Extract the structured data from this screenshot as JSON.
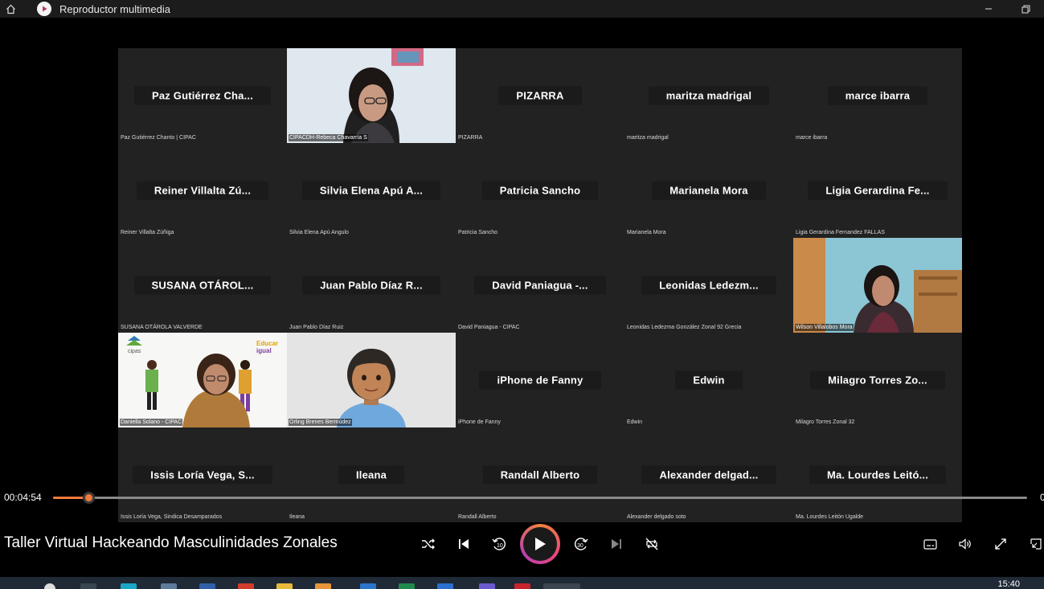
{
  "window": {
    "title": "Reproductor multimedia"
  },
  "tiles": [
    {
      "name": "Paz Gutiérrez Cha...",
      "label": "Paz Gutiérrez Chanto | CIPAC",
      "video": false
    },
    {
      "name": "",
      "label": "CIPACDH-Rebeca Chavarría S",
      "video": true
    },
    {
      "name": "PIZARRA",
      "label": "PIZARRA",
      "video": false
    },
    {
      "name": "maritza madrigal",
      "label": "maritza madrigal",
      "video": false
    },
    {
      "name": "marce ibarra",
      "label": "marce ibarra",
      "video": false
    },
    {
      "name": "Reiner Villalta Zú...",
      "label": "Reiner Villalta Zúñiga",
      "video": false
    },
    {
      "name": "Silvia Elena Apú A...",
      "label": "Silvia Elena Apú Angulo",
      "video": false
    },
    {
      "name": "Patricia Sancho",
      "label": "Patricia Sancho",
      "video": false
    },
    {
      "name": "Marianela Mora",
      "label": "Marianela Mora",
      "video": false
    },
    {
      "name": "Ligia Gerardina Fe...",
      "label": "Ligia Gerardina Fernandez FALLAS",
      "video": false
    },
    {
      "name": "SUSANA OTÁROL...",
      "label": "SUSANA OTÁROLA VALVERDE",
      "video": false
    },
    {
      "name": "Juan Pablo Díaz R...",
      "label": "Juan Pablo Díaz Ruiz",
      "video": false
    },
    {
      "name": "David Paniagua -...",
      "label": "David Paniagua - CIPAC",
      "video": false
    },
    {
      "name": "Leonidas Ledezm...",
      "label": "Leonidas Ledezma González Zonal 92 Grecia",
      "video": false
    },
    {
      "name": "",
      "label": "Wilson Villalobos Mora",
      "video": true
    },
    {
      "name": "",
      "label": "Daniella Solano - CIPAC",
      "video": true
    },
    {
      "name": "",
      "label": "Orling Brenes Bermúdez",
      "video": true
    },
    {
      "name": "iPhone de Fanny",
      "label": "iPhone de Fanny",
      "video": false
    },
    {
      "name": "Edwin",
      "label": "Edwin",
      "video": false
    },
    {
      "name": "Milagro Torres Zo...",
      "label": "Milagro Torres Zonal 32",
      "video": false
    },
    {
      "name": "Issis Loría Vega, S...",
      "label": "Issis Loría Vega, Sindica Desamparados",
      "video": false
    },
    {
      "name": "Ileana",
      "label": "Ileana",
      "video": false
    },
    {
      "name": "Randall Alberto",
      "label": "Randall Alberto",
      "video": false
    },
    {
      "name": "Alexander delgad...",
      "label": "Alexander delgado soto",
      "video": false
    },
    {
      "name": "Ma. Lourdes Leitó...",
      "label": "Ma. Lourdes Leitón Ugalde",
      "video": false
    }
  ],
  "slide_logos": {
    "left": "cipas",
    "right_line1": "Educar",
    "right_line2": "igual"
  },
  "player": {
    "current_time": "00:04:54",
    "remaining_time": "0",
    "progress_fraction": 0.036,
    "media_title": "Taller Virtual Hackeando Masculinidades Zonales"
  },
  "taskbar": {
    "clock": "15:40"
  },
  "colors": {
    "accent": "#f47a3c",
    "grid_bg": "#202020",
    "titlebar_bg": "#1c1c1c"
  }
}
